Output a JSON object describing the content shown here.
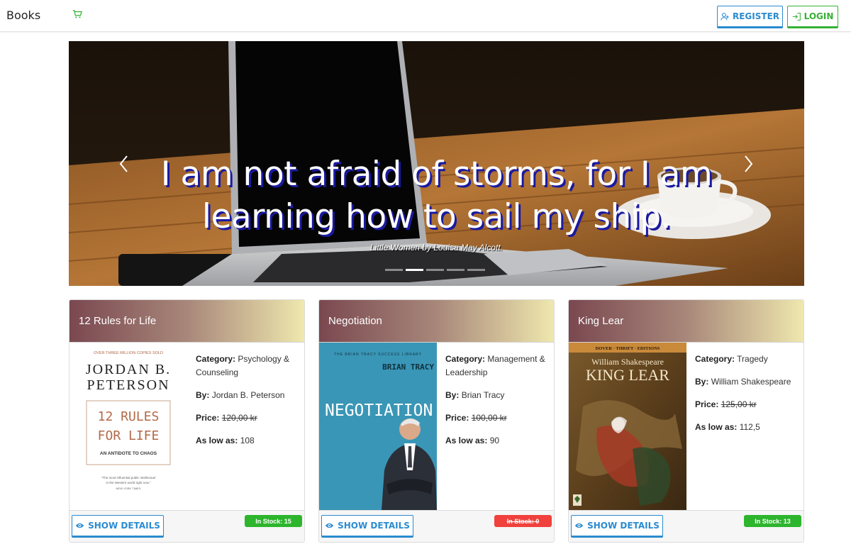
{
  "navbar": {
    "brand": "Books",
    "register_label": "REGISTER",
    "login_label": "LOGIN"
  },
  "carousel": {
    "quote_line1": "I am not afraid of storms, for I am",
    "quote_line2": "learning how to sail my ship.",
    "attribution": "Little Women by Louisa May Alcott.",
    "slide_count": 5,
    "active_slide": 2
  },
  "labels": {
    "category": "Category:",
    "by": "By:",
    "price": "Price:",
    "as_low_as": "As low as:",
    "show_details": "SHOW DETAILS"
  },
  "books": [
    {
      "title": "12 Rules for Life",
      "category": "Psychology & Counseling",
      "author": "Jordan B. Peterson",
      "price": "120,00 kr",
      "as_low_as": "108",
      "stock_label": "In Stock: 15",
      "in_stock": true,
      "cover": {
        "top_line": "OVER THREE MILLION COPIES SOLD",
        "author_first": "JORDAN B.",
        "author_last": "PETERSON",
        "title1": "12 RULES",
        "title2": "FOR LIFE",
        "subtitle": "AN ANTIDOTE TO CHAOS",
        "blurb1": "\"The most influential public intellectual",
        "blurb2": "in the Western world right now.\"",
        "blurb3": "NEW YORK TIMES"
      }
    },
    {
      "title": "Negotiation",
      "category": "Management & Leadership",
      "author": "Brian Tracy",
      "price": "100,00 kr",
      "as_low_as": "90",
      "stock_label": "In Stock: 0",
      "in_stock": false,
      "cover": {
        "series": "THE BRIAN TRACY SUCCESS LIBRARY",
        "author": "BRIAN TRACY",
        "title": "NEGOTIATION"
      }
    },
    {
      "title": "King Lear",
      "category": "Tragedy",
      "author": "William Shakespeare",
      "price": "125,00 kr",
      "as_low_as": "112,5",
      "stock_label": "In Stock: 13",
      "in_stock": true,
      "cover": {
        "series": "DOVER · THRIFT · EDITIONS",
        "author": "William Shakespeare",
        "title": "KING LEAR"
      }
    }
  ],
  "colors": {
    "primary": "#2a8bd0",
    "success": "#35b135",
    "stock_in": "#2db52d",
    "stock_out": "#f0413c"
  }
}
